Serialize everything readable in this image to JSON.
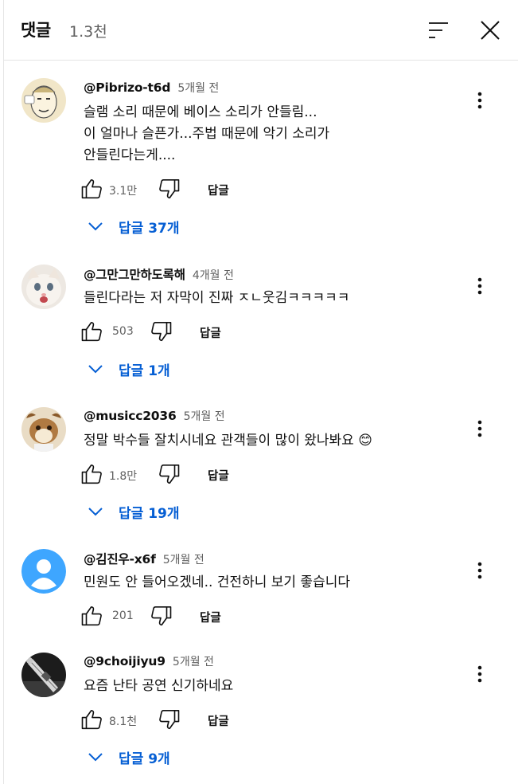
{
  "header": {
    "title": "댓글",
    "count": "1.3천",
    "sort_icon": "sort-icon",
    "close_icon": "close-icon"
  },
  "actions": {
    "reply_label": "답글"
  },
  "comments": [
    {
      "author": "@Pibrizo-t6d",
      "time": "5개월 전",
      "lines": [
        "슬램 소리 때문에 베이스 소리가 안들림...",
        "이 얼마나 슬픈가...주법 때문에 악기 소리가",
        "안들린다는게...."
      ],
      "likes": "3.1만",
      "replies": "답글 37개",
      "avatar": "cartoon-face-avatar"
    },
    {
      "author": "@그만그만하도록해",
      "time": "4개월 전",
      "lines": [
        "들린다라는 저 자막이 진짜 ㅈㄴ웃김ㅋㅋㅋㅋㅋ"
      ],
      "likes": "503",
      "replies": "답글 1개",
      "avatar": "cat-photo-avatar"
    },
    {
      "author": "@musicc2036",
      "time": "5개월 전",
      "lines": [
        "정말 박수들 잘치시네요 관객들이 많이 왔나봐요"
      ],
      "emoji": "😊",
      "likes": "1.8만",
      "replies": "답글 19개",
      "avatar": "cartoon-animal-avatar"
    },
    {
      "author": "@김진우-x6f",
      "time": "5개월 전",
      "lines": [
        "민원도 안 들어오겠네.. 건전하니 보기 좋습니다"
      ],
      "likes": "201",
      "replies": "",
      "avatar": "default-user-avatar"
    },
    {
      "author": "@9choijiyu9",
      "time": "5개월 전",
      "lines": [
        "요즘 난타 공연 신기하네요"
      ],
      "likes": "8.1천",
      "replies": "답글 9개",
      "avatar": "guitar-photo-avatar"
    }
  ],
  "colors": {
    "link": "#065fd4",
    "secondary_text": "#606060",
    "default_avatar": "#3ea6ff"
  }
}
